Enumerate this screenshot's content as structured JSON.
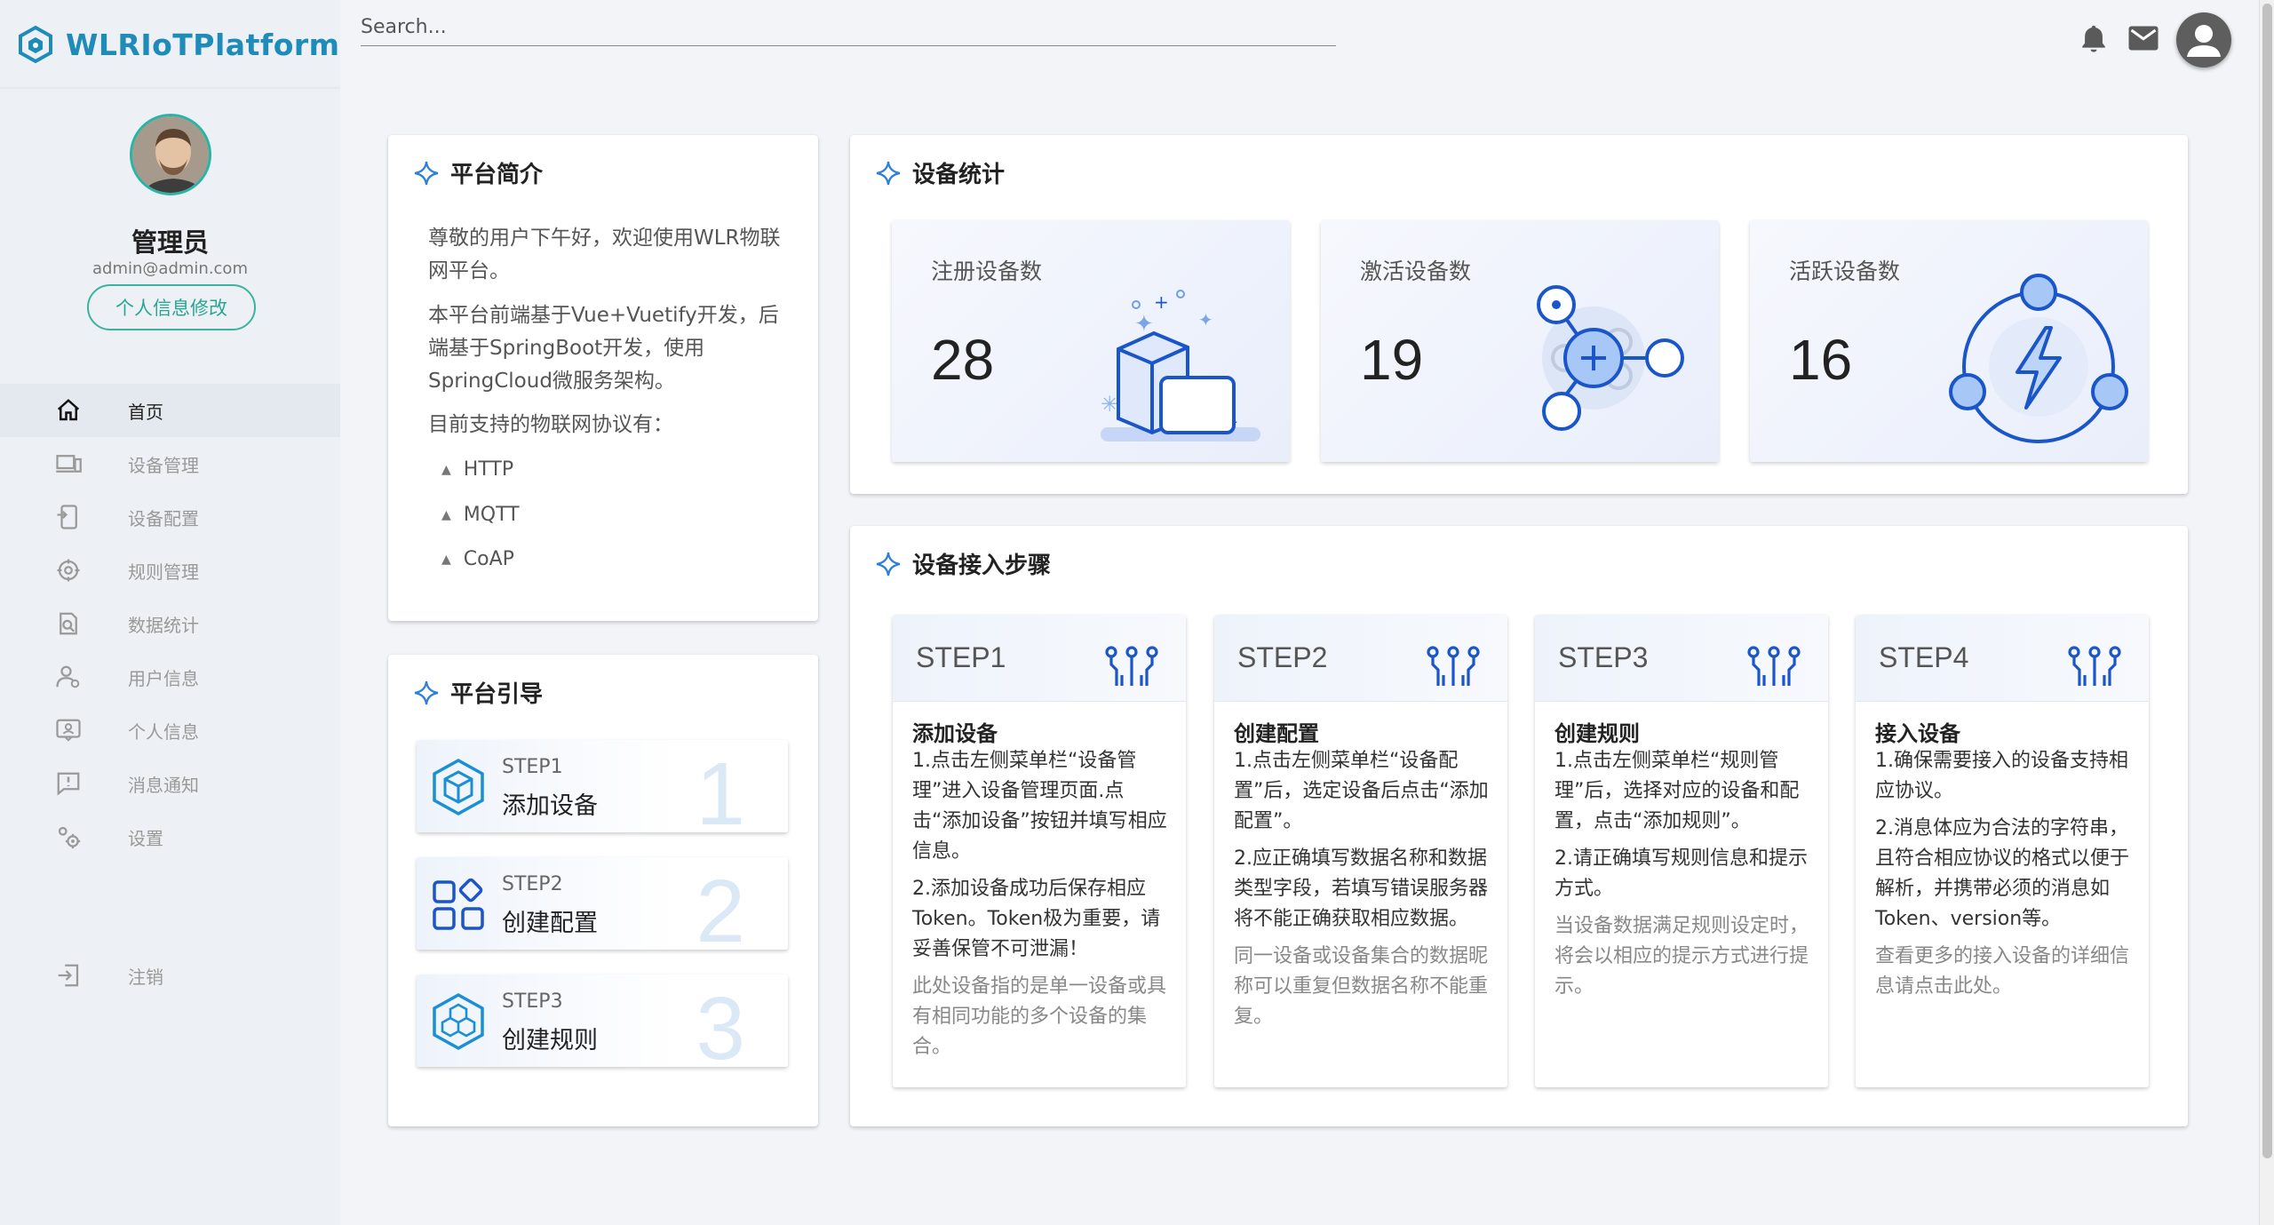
{
  "app": {
    "title": "WLRIoTPlatform"
  },
  "user": {
    "name": "管理员",
    "email": "admin@admin.com",
    "edit_label": "个人信息修改"
  },
  "nav": [
    {
      "label": "首页",
      "icon": "home-icon",
      "active": true
    },
    {
      "label": "设备管理",
      "icon": "devices-icon"
    },
    {
      "label": "设备配置",
      "icon": "device-config-icon"
    },
    {
      "label": "规则管理",
      "icon": "rules-icon"
    },
    {
      "label": "数据统计",
      "icon": "data-stats-icon"
    },
    {
      "label": "用户信息",
      "icon": "users-icon"
    },
    {
      "label": "个人信息",
      "icon": "profile-icon"
    },
    {
      "label": "消息通知",
      "icon": "message-icon"
    },
    {
      "label": "设置",
      "icon": "settings-icon"
    }
  ],
  "logout": {
    "label": "注销",
    "icon": "logout-icon"
  },
  "search": {
    "placeholder": "Search..."
  },
  "intro": {
    "title": "平台简介",
    "p1": "尊敬的用户下午好，欢迎使用WLR物联网平台。",
    "p2": "本平台前端基于Vue+Vuetify开发，后端基于SpringBoot开发，使用SpringCloud微服务架构。",
    "p3": "目前支持的物联网协议有：",
    "protocols": [
      "HTTP",
      "MQTT",
      "CoAP"
    ]
  },
  "guide": {
    "title": "平台引导",
    "items": [
      {
        "step": "STEP1",
        "label": "添加设备",
        "num": "1"
      },
      {
        "step": "STEP2",
        "label": "创建配置",
        "num": "2"
      },
      {
        "step": "STEP3",
        "label": "创建规则",
        "num": "3"
      }
    ]
  },
  "stats": {
    "title": "设备统计",
    "items": [
      {
        "label": "注册设备数",
        "value": "28"
      },
      {
        "label": "激活设备数",
        "value": "19"
      },
      {
        "label": "活跃设备数",
        "value": "16"
      }
    ]
  },
  "steps": {
    "title": "设备接入步骤",
    "items": [
      {
        "head": "STEP1",
        "title": "添加设备",
        "p1": "1.点击左侧菜单栏“设备管理”进入设备管理页面.点击“添加设备”按钮并填写相应信息。",
        "p2": "2.添加设备成功后保存相应Token。Token极为重要，请妥善保管不可泄漏！",
        "p3": "此处设备指的是单一设备或具有相同功能的多个设备的集合。"
      },
      {
        "head": "STEP2",
        "title": "创建配置",
        "p1": "1.点击左侧菜单栏“设备配置”后，选定设备后点击“添加配置”。",
        "p2": "2.应正确填写数据名称和数据类型字段，若填写错误服务器将不能正确获取相应数据。",
        "p3": "同一设备或设备集合的数据昵称可以重复但数据名称不能重复。"
      },
      {
        "head": "STEP3",
        "title": "创建规则",
        "p1": "1.点击左侧菜单栏“规则管理”后，选择对应的设备和配置，点击“添加规则”。",
        "p2": "2.请正确填写规则信息和提示方式。",
        "p3": "当设备数据满足规则设定时，将会以相应的提示方式进行提示。"
      },
      {
        "head": "STEP4",
        "title": "接入设备",
        "p1": "1.确保需要接入的设备支持相应协议。",
        "p2": "2.消息体应为合法的字符串，且符合相应协议的格式以便于解析，并携带必须的消息如Token、version等。",
        "p3": "查看更多的接入设备的详细信息请点击此处。"
      }
    ]
  },
  "colors": {
    "brand": "#1e8bb9",
    "accent": "#2aa594",
    "icon_blue": "#1a56c9"
  }
}
